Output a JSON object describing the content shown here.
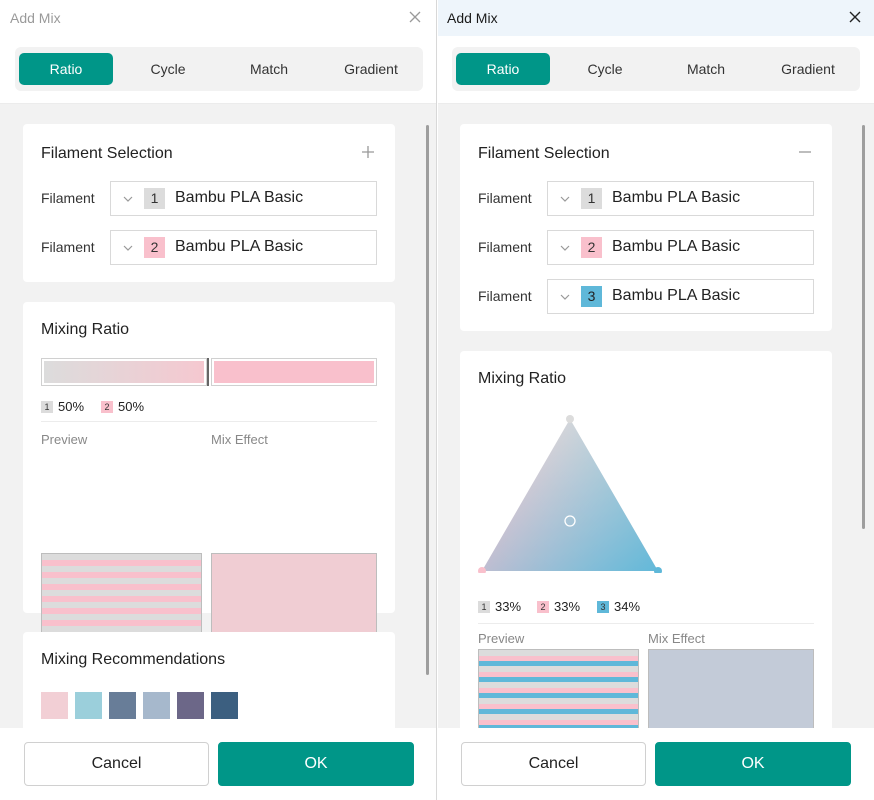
{
  "colors": {
    "accent": "#009688",
    "filament1": "#dcdcdc",
    "filament2": "#f9c0cc",
    "filament3": "#5fb8d9"
  },
  "left": {
    "title": "Add Mix",
    "close_icon": "close-icon",
    "tabs": [
      "Ratio",
      "Cycle",
      "Match",
      "Gradient"
    ],
    "active_tab": "Ratio",
    "filament_selection": {
      "title": "Filament Selection",
      "action_icon": "plus-icon",
      "rows": [
        {
          "label": "Filament",
          "number": "1",
          "name": "Bambu PLA Basic"
        },
        {
          "label": "Filament",
          "number": "2",
          "name": "Bambu PLA Basic"
        }
      ]
    },
    "mixing_ratio": {
      "title": "Mixing Ratio",
      "split_fraction": 0.5,
      "percents": [
        {
          "number": "1",
          "value": "50%"
        },
        {
          "number": "2",
          "value": "50%"
        }
      ],
      "preview_label": "Preview",
      "mix_effect_label": "Mix Effect",
      "mix_effect_color": "#f0cdd3"
    },
    "recommendations": {
      "title": "Mixing Recommendations",
      "swatches": [
        "#f2cfd5",
        "#9bcfdb",
        "#687d98",
        "#a6b8cc",
        "#6c6788",
        "#3c5f80"
      ]
    },
    "cancel_label": "Cancel",
    "ok_label": "OK"
  },
  "right": {
    "title": "Add Mix",
    "close_icon": "close-icon",
    "tabs": [
      "Ratio",
      "Cycle",
      "Match",
      "Gradient"
    ],
    "active_tab": "Ratio",
    "filament_selection": {
      "title": "Filament Selection",
      "action_icon": "minus-icon",
      "rows": [
        {
          "label": "Filament",
          "number": "1",
          "name": "Bambu PLA Basic"
        },
        {
          "label": "Filament",
          "number": "2",
          "name": "Bambu PLA Basic"
        },
        {
          "label": "Filament",
          "number": "3",
          "name": "Bambu PLA Basic"
        }
      ]
    },
    "mixing_ratio": {
      "title": "Mixing Ratio",
      "percents": [
        {
          "number": "1",
          "value": "33%"
        },
        {
          "number": "2",
          "value": "33%"
        },
        {
          "number": "3",
          "value": "34%"
        }
      ],
      "preview_label": "Preview",
      "mix_effect_label": "Mix Effect",
      "mix_effect_color": "#c3cbd8"
    },
    "cancel_label": "Cancel",
    "ok_label": "OK"
  }
}
